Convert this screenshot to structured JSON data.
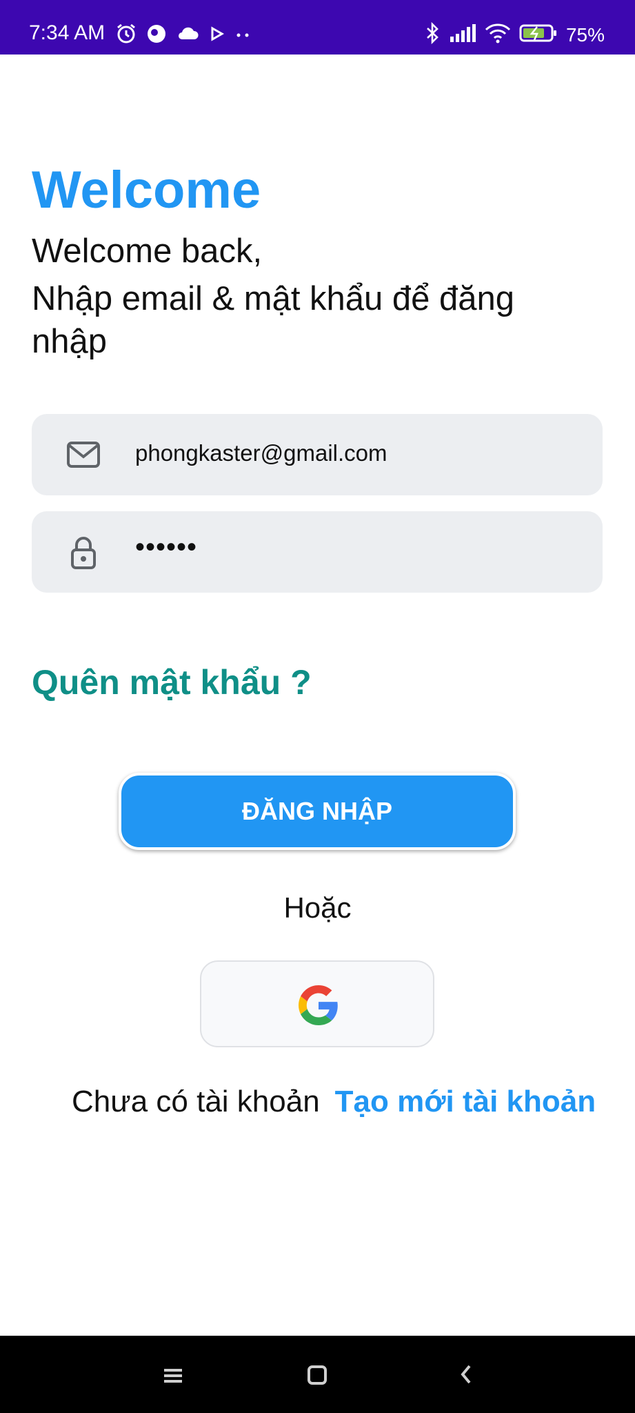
{
  "status_bar": {
    "time": "7:34 AM",
    "battery": "75%",
    "left_icons": [
      "alarm-icon",
      "messenger-icon",
      "cloud-icon",
      "play-icon",
      "more-dots-icon"
    ],
    "right_icons": [
      "bluetooth-icon",
      "signal-icon",
      "wifi-icon",
      "battery-icon"
    ],
    "background": "#3d07b0"
  },
  "header": {
    "title": "Welcome",
    "subtitle_line1": "Welcome back,",
    "subtitle_line2": "Nhập email & mật khẩu để đăng nhập"
  },
  "form": {
    "email": {
      "value": "phongkaster@gmail.com",
      "icon": "mail-icon"
    },
    "password": {
      "value": "••••••",
      "icon": "lock-icon"
    },
    "forgot_label": "Quên mật khẩu ?",
    "login_label": "ĐĂNG NHẬP",
    "or_label": "Hoặc",
    "google_icon": "google-icon"
  },
  "signup": {
    "question": "Chưa có tài khoản",
    "link": "Tạo mới tài khoản"
  },
  "nav_bar": {
    "icons": [
      "menu-icon",
      "home-icon",
      "back-icon"
    ]
  },
  "colors": {
    "accent": "#2196f3",
    "forgot": "#0f8f87",
    "field_bg": "#eceef1"
  }
}
